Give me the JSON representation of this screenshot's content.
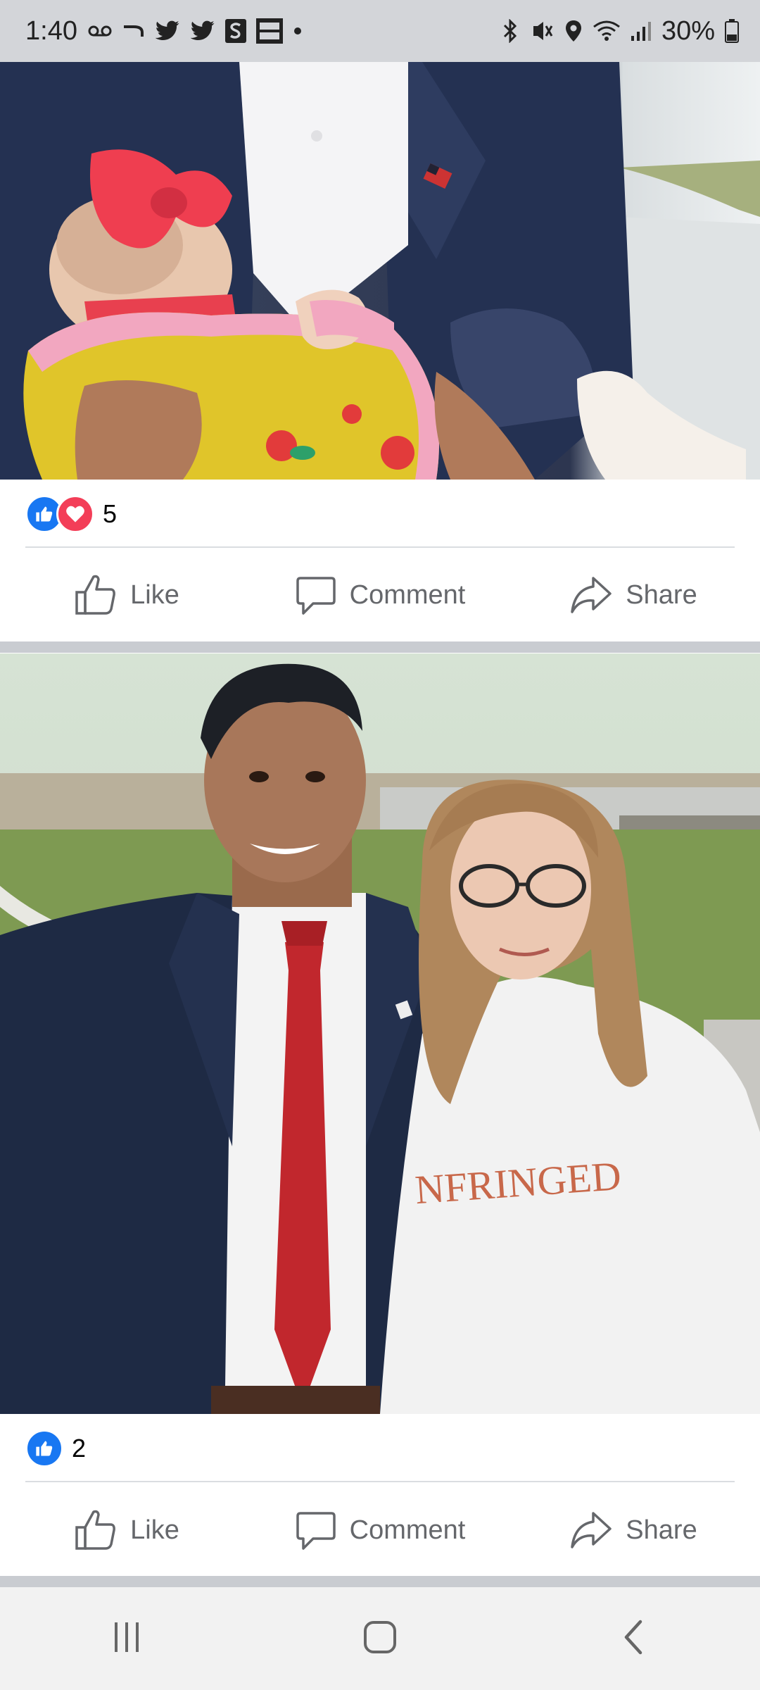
{
  "status_bar": {
    "time": "1:40",
    "battery": "30%",
    "notification_icons": [
      "voicemail-icon",
      "missed-call-icon",
      "twitter-icon",
      "twitter-icon",
      "s-app-icon",
      "fox-news-icon",
      "dot-icon"
    ],
    "system_icons": [
      "bluetooth-icon",
      "vibrate-icon",
      "location-icon",
      "wifi-icon",
      "signal-icon",
      "battery-icon"
    ]
  },
  "posts": [
    {
      "photo": "photo of man in suit holding a baby",
      "reactions": [
        "like",
        "love"
      ],
      "reaction_count": "5",
      "actions": {
        "like": "Like",
        "comment": "Comment",
        "share": "Share"
      }
    },
    {
      "photo": "photo of man in suit with red tie and woman in white sweatshirt",
      "reactions": [
        "like"
      ],
      "reaction_count": "2",
      "actions": {
        "like": "Like",
        "comment": "Comment",
        "share": "Share"
      }
    }
  ],
  "colors": {
    "like_blue": "#1877f2",
    "love_red": "#f33e58",
    "action_gray": "#65676b",
    "separator": "#c9ccd1"
  },
  "nav_bar": [
    "recent-apps",
    "home",
    "back"
  ]
}
